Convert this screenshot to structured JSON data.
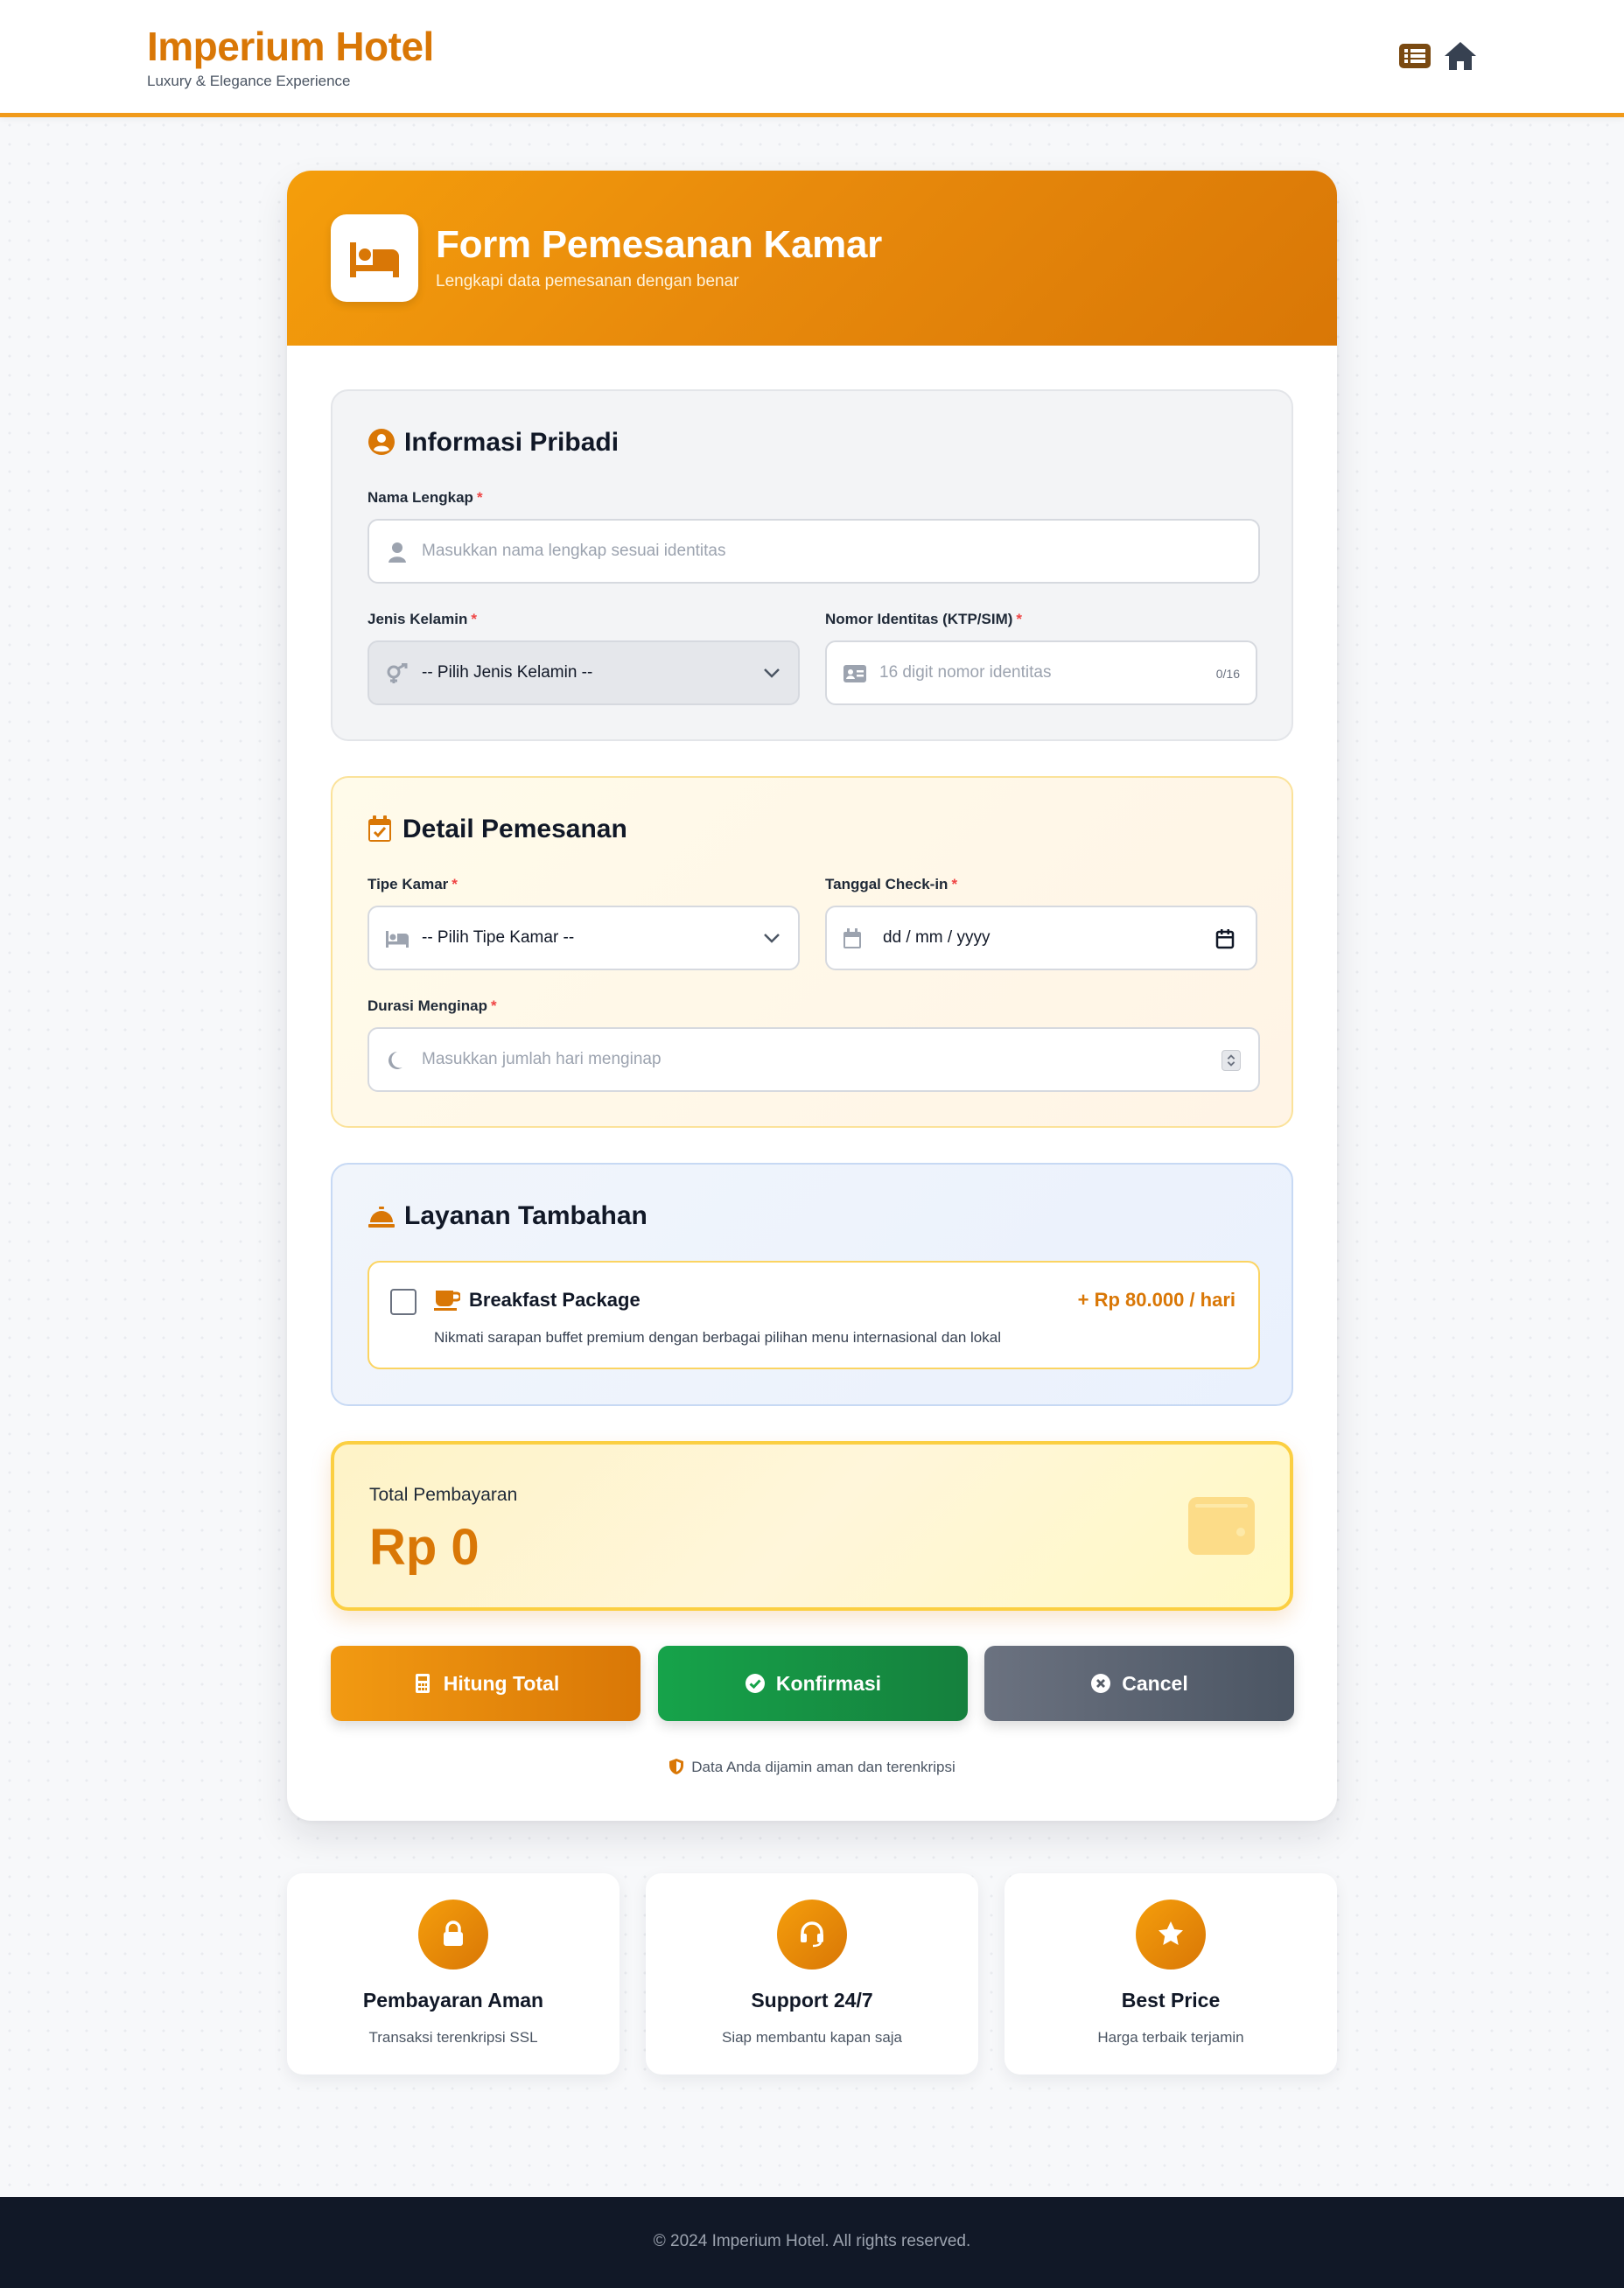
{
  "header": {
    "brand_title": "Imperium Hotel",
    "brand_subtitle": "Luxury & Elegance Experience",
    "icons": [
      "list-icon",
      "home-icon"
    ]
  },
  "form": {
    "title": "Form Pemesanan Kamar",
    "subtitle": "Lengkapi data pemesanan dengan benar",
    "personal": {
      "title": "Informasi Pribadi",
      "name_label": "Nama Lengkap",
      "name_placeholder": "Masukkan nama lengkap sesuai identitas",
      "gender_label": "Jenis Kelamin",
      "gender_selected": "-- Pilih Jenis Kelamin --",
      "id_label": "Nomor Identitas (KTP/SIM)",
      "id_placeholder": "16 digit nomor identitas",
      "id_counter": "0/16"
    },
    "booking": {
      "title": "Detail Pemesanan",
      "room_label": "Tipe Kamar",
      "room_selected": "-- Pilih Tipe Kamar --",
      "checkin_label": "Tanggal Check-in",
      "checkin_value": "dd / mm / yyyy",
      "duration_label": "Durasi Menginap",
      "duration_placeholder": "Masukkan jumlah hari menginap"
    },
    "services": {
      "title": "Layanan Tambahan",
      "addon_title": "Breakfast Package",
      "addon_price": "+ Rp 80.000 / hari",
      "addon_desc": "Nikmati sarapan buffet premium dengan berbagai pilihan menu internasional dan lokal",
      "addon_checked": false
    },
    "required_mark": "*",
    "total": {
      "label": "Total Pembayaran",
      "value": "Rp 0"
    },
    "buttons": {
      "calc": "Hitung Total",
      "confirm": "Konfirmasi",
      "cancel": "Cancel"
    },
    "secure_note": "Data Anda dijamin aman dan terenkripsi"
  },
  "features": [
    {
      "title": "Pembayaran Aman",
      "subtitle": "Transaksi terenkripsi SSL",
      "icon": "lock-icon"
    },
    {
      "title": "Support 24/7",
      "subtitle": "Siap membantu kapan saja",
      "icon": "headset-icon"
    },
    {
      "title": "Best Price",
      "subtitle": "Harga terbaik terjamin",
      "icon": "star-icon"
    }
  ],
  "footer": {
    "text": "© 2024 Imperium Hotel. All rights reserved."
  },
  "colors": {
    "accent": "#d97706",
    "accent_light": "#f59e0b",
    "success": "#16a34a",
    "neutral": "#6b7280",
    "footer_bg": "#111827"
  }
}
